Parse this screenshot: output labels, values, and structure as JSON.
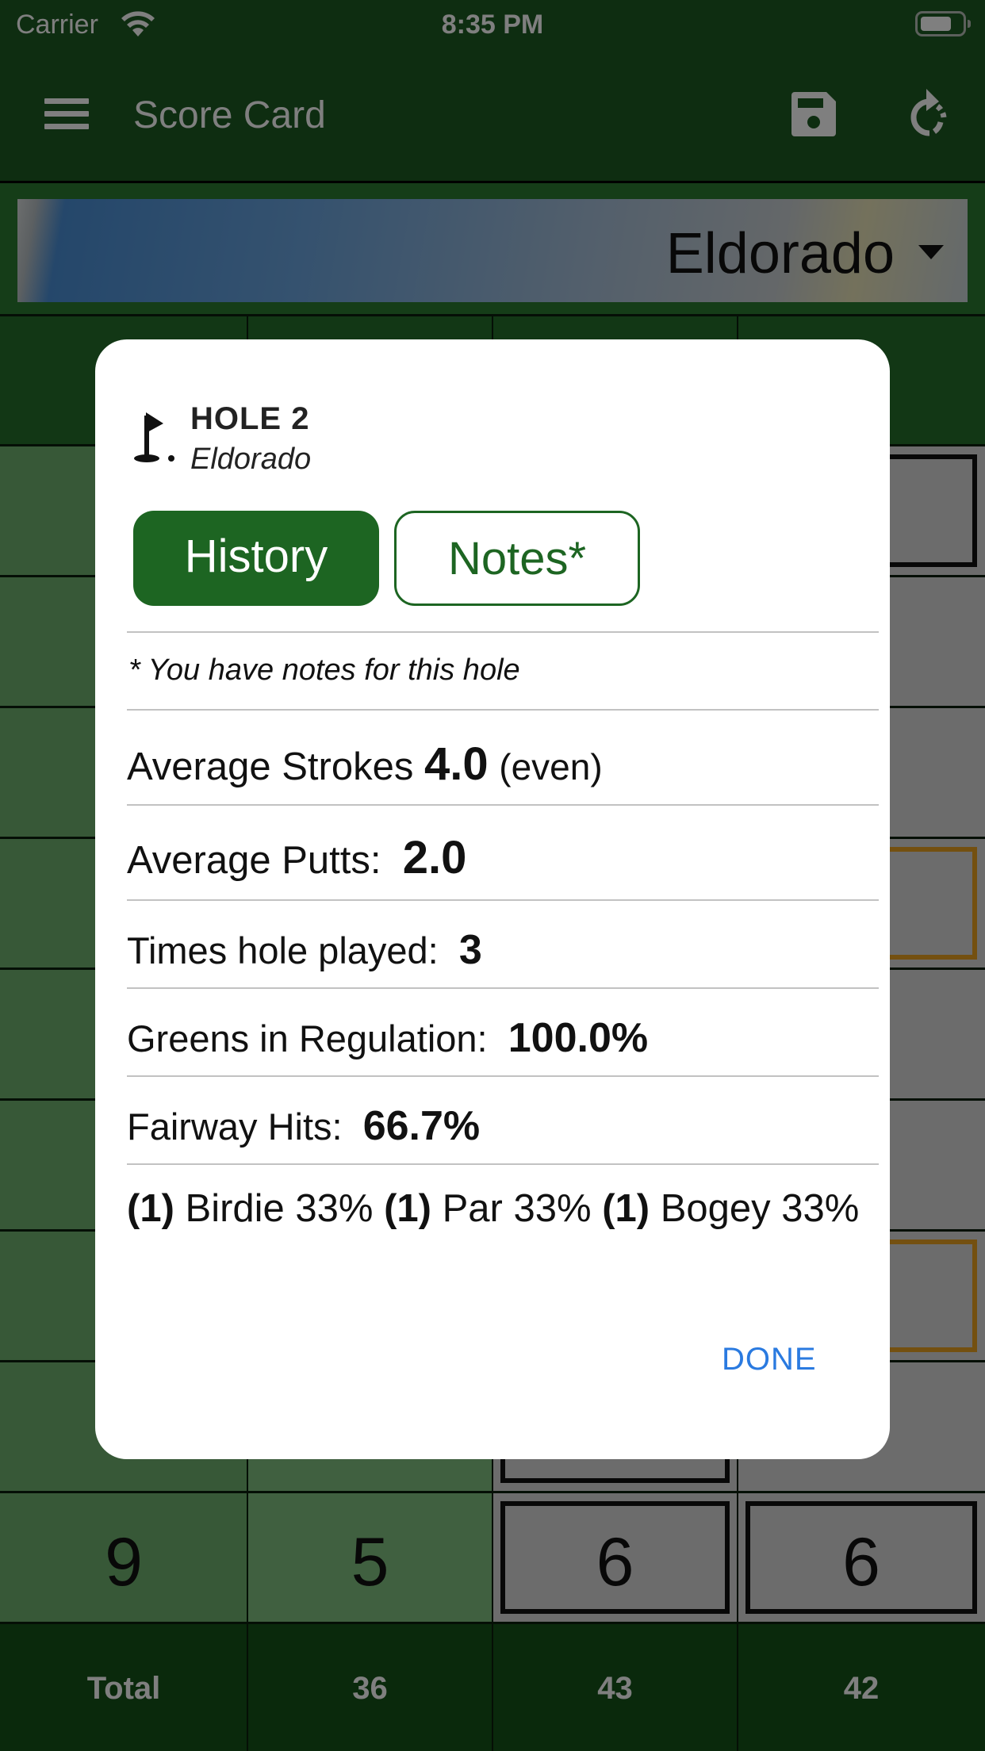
{
  "status_bar": {
    "carrier": "Carrier",
    "time": "8:35 PM",
    "wifi_icon": "wifi-icon",
    "battery_icon": "battery-icon"
  },
  "nav": {
    "title": "Score Card",
    "menu_icon": "hamburger-menu-icon",
    "save_icon": "floppy-disk-save-icon",
    "refresh_icon": "refresh-icon"
  },
  "course_selector": {
    "selected": "Eldorado",
    "caret_icon": "caret-down-icon"
  },
  "scorecard": {
    "visible_row": [
      "9",
      "5",
      "6",
      "6"
    ],
    "totals": [
      "Total",
      "36",
      "43",
      "42"
    ]
  },
  "modal": {
    "flag_icon": "golf-flag-icon",
    "hole_title": "HOLE 2",
    "course": "Eldorado",
    "tabs": [
      {
        "label": "History",
        "active": true
      },
      {
        "label": "Notes*",
        "active": false
      }
    ],
    "notes_hint": "* You have notes for this hole",
    "stats": {
      "avg_strokes": {
        "label": "Average Strokes",
        "value": "4.0",
        "suffix": "(even)"
      },
      "avg_putts": {
        "label": "Average Putts:",
        "value": "2.0"
      },
      "times_played": {
        "label": "Times hole played:",
        "value": "3"
      },
      "gir": {
        "label": "Greens in Regulation:",
        "value": "100.0%"
      },
      "fairway_hits": {
        "label": "Fairway Hits:",
        "value": "66.7%"
      }
    },
    "distribution": [
      {
        "count": "(1)",
        "label": "Birdie 33%"
      },
      {
        "count": "(1)",
        "label": "Par 33%"
      },
      {
        "count": "(1)",
        "label": "Bogey 33%"
      }
    ],
    "done_label": "DONE"
  },
  "colors": {
    "brand_green": "#1d6522",
    "link_blue": "#2a7ae0",
    "bogey_orange": "#e8a020"
  }
}
